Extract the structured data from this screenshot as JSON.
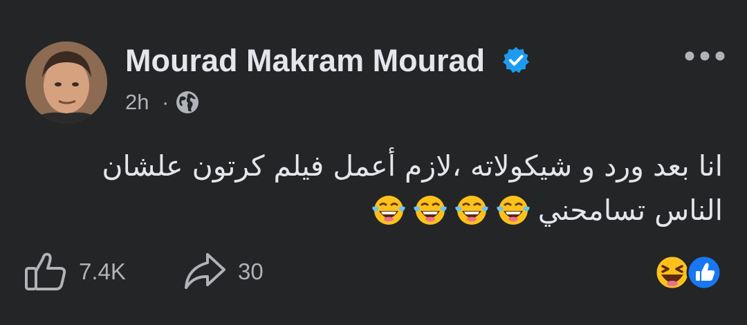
{
  "post": {
    "author": {
      "name": "Mourad Makram Mourad",
      "verified": true,
      "avatar_icon": "avatar-photo"
    },
    "meta": {
      "timestamp": "2h",
      "separator": "·",
      "audience_icon": "globe-icon"
    },
    "menu_icon": "more-options-icon",
    "text": "انا بعد ورد و شيكولاته ،لازم أعمل فيلم كرتون علشان الناس تسامحني",
    "text_emojis": [
      "face-with-tears-of-joy",
      "face-with-tears-of-joy",
      "face-with-tears-of-joy",
      "face-with-tears-of-joy"
    ],
    "actions": {
      "like_count": "7.4K",
      "share_count": "30"
    },
    "reactions": [
      "haha",
      "like"
    ]
  },
  "colors": {
    "background": "#242526",
    "primary_text": "#e4e6eb",
    "secondary_text": "#b0b3b8",
    "verified_blue": "#1d9bf0",
    "like_blue": "#1877f2",
    "emoji_yellow": "#fcc21b"
  }
}
